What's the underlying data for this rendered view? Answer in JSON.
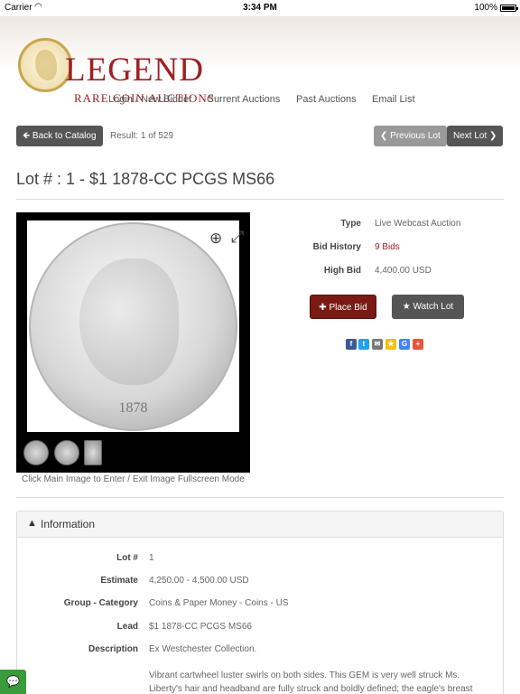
{
  "statusbar": {
    "carrier": "Carrier",
    "time": "3:34 PM",
    "battery": "100%"
  },
  "header": {
    "brand": "LEGEND",
    "tagline": "RARE COIN AUCTIONS",
    "nav": [
      "Login / New Bidder",
      "Current Auctions",
      "Past Auctions",
      "Email List"
    ]
  },
  "toolbar": {
    "back_label": "Back to Catalog",
    "result": "Result: 1 of 529",
    "prev_label": "Previous Lot",
    "next_label": "Next Lot"
  },
  "lot": {
    "title": "Lot # : 1 - $1 1878-CC PCGS MS66",
    "coin_date": "1878",
    "image_caption": "Click Main Image to Enter / Exit Image Fullscreen Mode",
    "details": [
      {
        "label": "Type",
        "value": "Live Webcast Auction"
      },
      {
        "label": "Bid History",
        "value": "9 Bids"
      },
      {
        "label": "High Bid",
        "value": "4,400.00 USD"
      }
    ],
    "place_bid_label": "Place Bid",
    "watch_lot_label": "Watch Lot"
  },
  "share_icons": [
    {
      "name": "facebook-icon",
      "glyph": "f",
      "color": "#3b5998"
    },
    {
      "name": "twitter-icon",
      "glyph": "t",
      "color": "#1da1f2"
    },
    {
      "name": "email-icon",
      "glyph": "✉",
      "color": "#777777"
    },
    {
      "name": "favorite-icon",
      "glyph": "★",
      "color": "#f4c20d"
    },
    {
      "name": "google-icon",
      "glyph": "G",
      "color": "#4285f4"
    },
    {
      "name": "share-plus-icon",
      "glyph": "+",
      "color": "#e8553e"
    }
  ],
  "information": {
    "heading": "Information",
    "rows": [
      {
        "label": "Lot #",
        "value": "1"
      },
      {
        "label": "Estimate",
        "value": "4,250.00 - 4,500.00 USD"
      },
      {
        "label": "Group - Category",
        "value": "Coins & Paper Money - Coins - US"
      },
      {
        "label": "Lead",
        "value": "$1 1878-CC PCGS MS66"
      },
      {
        "label": "Description",
        "value": "Ex Westchester Collection."
      }
    ],
    "description_text": "Vibrant cartwheel luster swirls on both sides. This GEM is very well struck Ms. Liberty's hair and headband are fully struck and boldly defined; the eagle's breast"
  }
}
